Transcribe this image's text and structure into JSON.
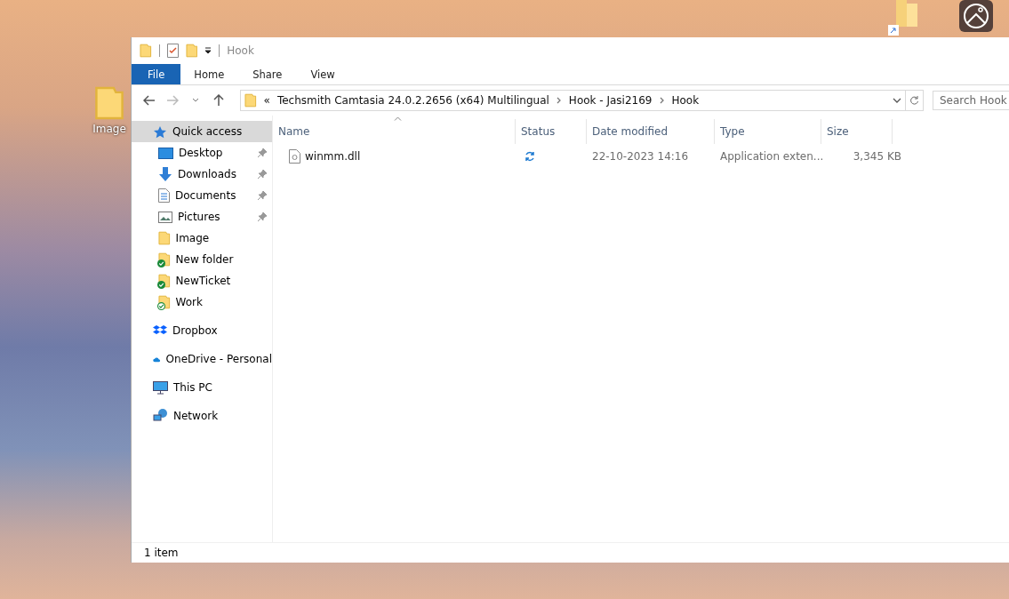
{
  "desktop": {
    "icons": [
      {
        "label": "Image"
      }
    ]
  },
  "window": {
    "title": "Hook",
    "ribbon_tabs": [
      {
        "label": "File",
        "selected": true
      },
      {
        "label": "Home",
        "selected": false
      },
      {
        "label": "Share",
        "selected": false
      },
      {
        "label": "View",
        "selected": false
      }
    ],
    "address": {
      "overflow": "«",
      "segments": [
        "Techsmith Camtasia 24.0.2.2656 (x64) Multilingual",
        "Hook - Jasi2169",
        "Hook"
      ]
    },
    "search": {
      "placeholder": "Search Hook"
    },
    "sidebar": {
      "items": [
        {
          "label": "Quick access",
          "kind": "quick",
          "selected": true,
          "children": [
            {
              "label": "Desktop",
              "kind": "desktop",
              "pinned": true,
              "sync_badge": false
            },
            {
              "label": "Downloads",
              "kind": "downloads",
              "pinned": true,
              "sync_badge": false
            },
            {
              "label": "Documents",
              "kind": "documents",
              "pinned": true,
              "sync_badge": false
            },
            {
              "label": "Pictures",
              "kind": "pictures",
              "pinned": true,
              "sync_badge": false
            },
            {
              "label": "Image",
              "kind": "folder",
              "pinned": false,
              "sync_badge": false
            },
            {
              "label": "New folder",
              "kind": "folder",
              "pinned": false,
              "sync_badge": true,
              "always_available": true
            },
            {
              "label": "NewTicket",
              "kind": "folder",
              "pinned": false,
              "sync_badge": true,
              "always_available": true
            },
            {
              "label": "Work",
              "kind": "folder",
              "pinned": false,
              "sync_badge": true,
              "always_available": false
            }
          ]
        },
        {
          "label": "Dropbox",
          "kind": "dropbox",
          "selected": false
        },
        {
          "label": "OneDrive - Personal",
          "kind": "onedrive",
          "selected": false
        },
        {
          "label": "This PC",
          "kind": "pc",
          "selected": false
        },
        {
          "label": "Network",
          "kind": "network",
          "selected": false
        }
      ]
    },
    "table": {
      "columns": [
        {
          "label": "Name",
          "sorted": true
        },
        {
          "label": "Status",
          "sorted": false
        },
        {
          "label": "Date modified",
          "sorted": false
        },
        {
          "label": "Type",
          "sorted": false
        },
        {
          "label": "Size",
          "sorted": false
        }
      ],
      "rows": [
        {
          "name": "winmm.dll",
          "syncing": true,
          "date": "22-10-2023 14:16",
          "type": "Application exten...",
          "size": "3,345 KB"
        }
      ]
    },
    "status_bar": "1 item"
  }
}
